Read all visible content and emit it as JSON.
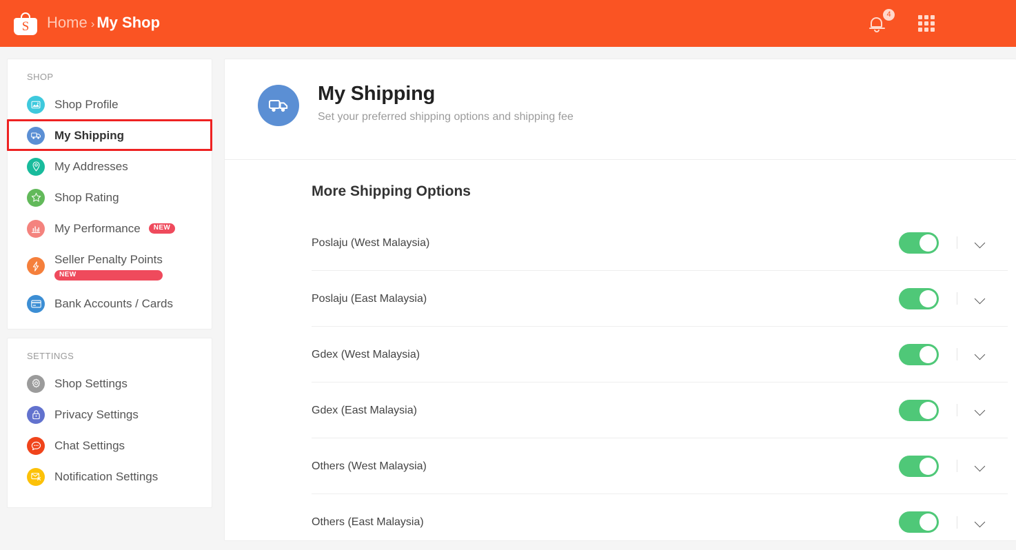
{
  "header": {
    "logo_icon": "shopee-bag-logo",
    "logo_letter": "S",
    "breadcrumb_home": "Home",
    "breadcrumb_separator": "›",
    "breadcrumb_current": "My Shop",
    "notification_icon": "bell-icon",
    "notification_count": "4",
    "apps_icon": "grid-apps-icon",
    "bg_color": "#fa5423"
  },
  "sidebar": {
    "shop_section_title": "SHOP",
    "settings_section_title": "SETTINGS",
    "shop_items": [
      {
        "label": "Shop Profile",
        "icon": "shop-profile-icon",
        "color": "#3ec9dd",
        "badge": "",
        "active": false
      },
      {
        "label": "My Shipping",
        "icon": "truck-icon",
        "color": "#5b8fd4",
        "badge": "",
        "active": true
      },
      {
        "label": "My Addresses",
        "icon": "location-pin-icon",
        "color": "#18bb9c",
        "badge": "",
        "active": false
      },
      {
        "label": "Shop Rating",
        "icon": "star-icon",
        "color": "#62b95a",
        "badge": "",
        "active": false
      },
      {
        "label": "My Performance",
        "icon": "bar-chart-icon",
        "color": "#f4837e",
        "badge": "NEW",
        "active": false
      },
      {
        "label": "Seller Penalty Points",
        "icon": "lightning-bolt-icon",
        "color": "#f57f3b",
        "badge": "NEW",
        "active": false
      },
      {
        "label": "Bank Accounts / Cards",
        "icon": "credit-card-icon",
        "color": "#3c8ed4",
        "badge": "",
        "active": false
      }
    ],
    "settings_items": [
      {
        "label": "Shop Settings",
        "icon": "gear-icon",
        "color": "#9b9b9b"
      },
      {
        "label": "Privacy Settings",
        "icon": "lock-icon",
        "color": "#6272ce"
      },
      {
        "label": "Chat Settings",
        "icon": "chat-bubble-icon",
        "color": "#f0441b"
      },
      {
        "label": "Notification Settings",
        "icon": "notification-mail-icon",
        "color": "#fcc108"
      }
    ],
    "highlight_color": "#ee2222",
    "highlighted_item": "My Shipping"
  },
  "main": {
    "page_icon": "truck-icon",
    "page_title": "My Shipping",
    "page_subtitle": "Set your preferred shipping options and shipping fee",
    "section_title": "More Shipping Options",
    "toggle_on_color": "#4fc878",
    "shipping_options": [
      {
        "name": "Poslaju (West Malaysia)",
        "enabled": true,
        "expand_icon": "chevron-down-icon"
      },
      {
        "name": "Poslaju (East Malaysia)",
        "enabled": true,
        "expand_icon": "chevron-down-icon"
      },
      {
        "name": "Gdex (West Malaysia)",
        "enabled": true,
        "expand_icon": "chevron-down-icon"
      },
      {
        "name": "Gdex (East Malaysia)",
        "enabled": true,
        "expand_icon": "chevron-down-icon"
      },
      {
        "name": "Others (West Malaysia)",
        "enabled": true,
        "expand_icon": "chevron-down-icon"
      },
      {
        "name": "Others (East Malaysia)",
        "enabled": true,
        "expand_icon": "chevron-down-icon"
      }
    ]
  }
}
